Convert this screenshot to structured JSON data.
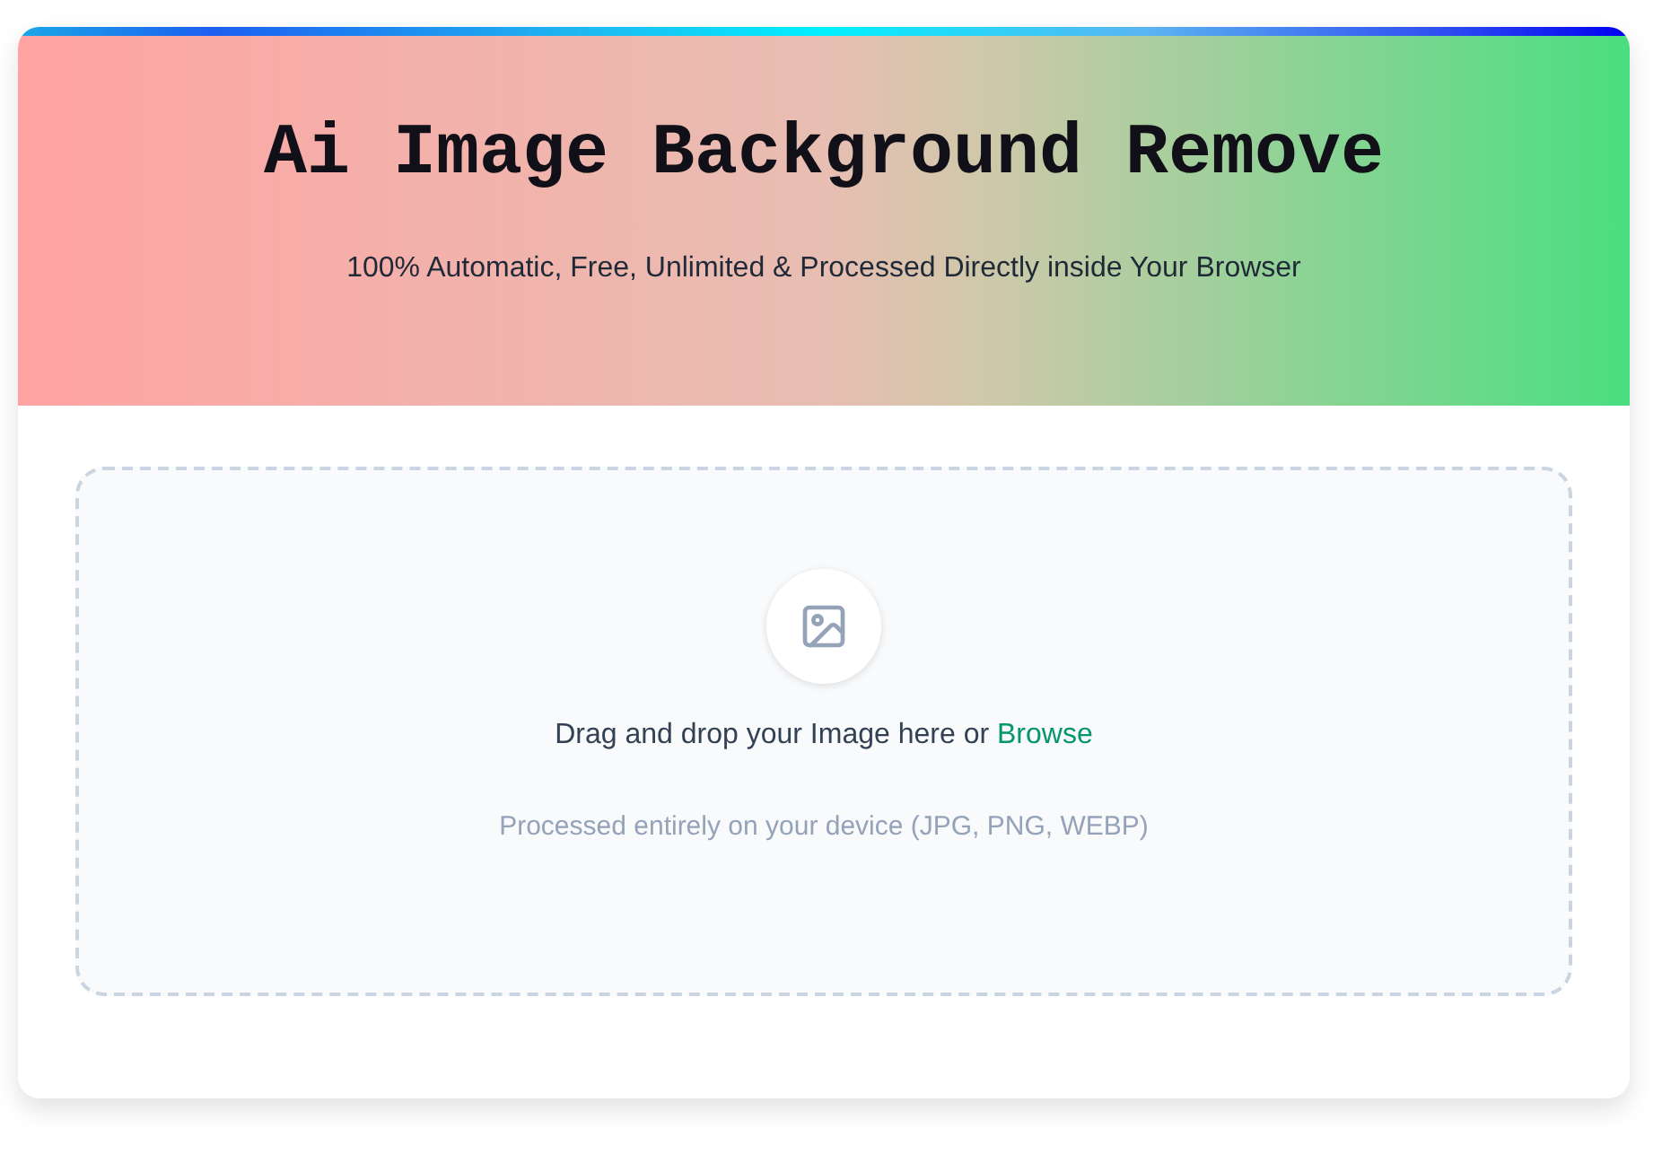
{
  "header": {
    "title": "Ai Image Background Remove",
    "subtitle": "100% Automatic, Free, Unlimited & Processed Directly inside Your Browser"
  },
  "dropzone": {
    "prompt": "Drag and drop your Image here or",
    "link": "Browse",
    "note": "Processed entirely on your device (JPG, PNG, WEBP)"
  }
}
